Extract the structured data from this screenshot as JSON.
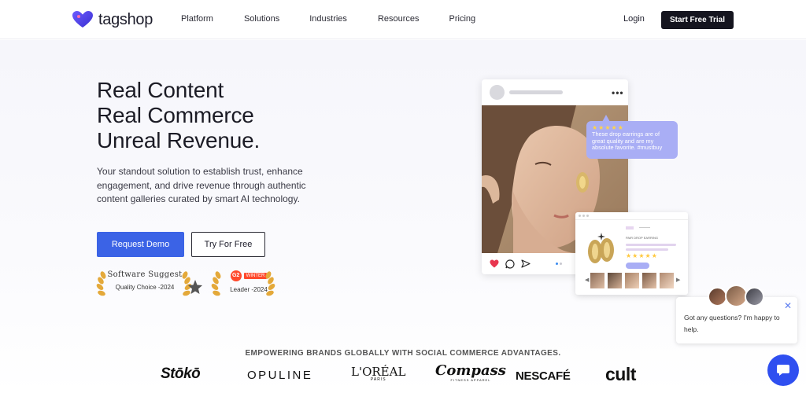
{
  "brand": {
    "name": "tagshop"
  },
  "nav": {
    "links": [
      "Platform",
      "Solutions",
      "Industries",
      "Resources",
      "Pricing"
    ],
    "login": "Login",
    "trial": "Start Free Trial"
  },
  "hero": {
    "headline": [
      "Real Content",
      "Real Commerce",
      "Unreal Revenue."
    ],
    "subtext": "Your standout solution to establish trust, enhance engagement, and drive revenue through authentic content galleries curated by smart AI technology.",
    "primary_button": "Request Demo",
    "secondary_button": "Try For Free"
  },
  "awards": [
    {
      "name": "Software Suggest",
      "caption": "Quality Choice -2024"
    },
    {
      "name": "G2",
      "badge": "WINTER",
      "caption": "Leader -2024"
    }
  ],
  "preview": {
    "review_stars": "★★★★★",
    "review_text": "These drop earrings are of great quality and are my absolute favorite. #mustbuy",
    "product_title": "PAIR DROP EARRING",
    "product_stars": "★★★★★"
  },
  "chat": {
    "message": "Got any questions? I'm happy to help.",
    "close": "✕"
  },
  "brands": {
    "tagline": "EMPOWERING BRANDS GLOBALLY WITH SOCIAL COMMERCE ADVANTAGES.",
    "logos": [
      "Stōkō",
      "OPULINE",
      "L'ORÉAL",
      "Compass",
      "NESCAFÉ",
      "cult"
    ],
    "loreal_sub": "PARIS",
    "compass_sub": "FITNESS APPAREL"
  },
  "colors": {
    "accent": "#3b63e6",
    "dark": "#15151f",
    "review": "#a9aef5",
    "chat": "#2f4ff0"
  }
}
